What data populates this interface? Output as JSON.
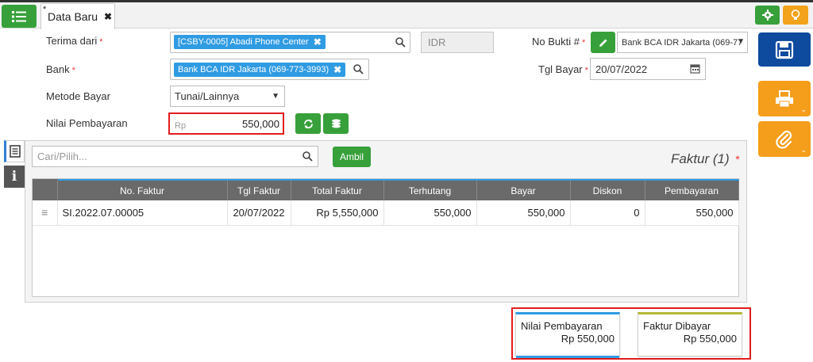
{
  "tab": {
    "title": "Data Baru",
    "modified_mark": "*"
  },
  "form": {
    "terima_dari": {
      "label": "Terima dari",
      "value": "[CSBY-0005] Abadi Phone Center"
    },
    "currency": "IDR",
    "bank": {
      "label": "Bank",
      "value": "Bank BCA IDR Jakarta (069-773-3993)"
    },
    "no_bukti": {
      "label": "No Bukti #",
      "value": "Bank BCA IDR Jakarta (069-77"
    },
    "tgl_bayar": {
      "label": "Tgl Bayar",
      "value": "20/07/2022"
    },
    "metode_bayar": {
      "label": "Metode Bayar",
      "value": "Tunai/Lainnya"
    },
    "nilai_pembayaran": {
      "label": "Nilai Pembayaran",
      "prefix": "Rp",
      "value": "550,000"
    },
    "required_mark": "*"
  },
  "faktur": {
    "search_placeholder": "Cari/Pilih...",
    "ambil_label": "Ambil",
    "title": "Faktur (1)",
    "columns": [
      "",
      "No. Faktur",
      "Tgl Faktur",
      "Total Faktur",
      "Terhutang",
      "Bayar",
      "Diskon",
      "Pembayaran"
    ],
    "rows": [
      {
        "grip": "≡",
        "no_faktur": "SI.2022.07.00005",
        "tgl_faktur": "20/07/2022",
        "total_faktur": "Rp 5,550,000",
        "terhutang": "550,000",
        "bayar": "550,000",
        "diskon": "0",
        "pembayaran": "550,000"
      }
    ]
  },
  "summary": {
    "nilai_pembayaran": {
      "label": "Nilai Pembayaran",
      "value": "Rp 550,000"
    },
    "faktur_dibayar": {
      "label": "Faktur Dibayar",
      "value": "Rp 550,000"
    }
  },
  "colors": {
    "green": "#37a03a",
    "orange": "#f59e1b",
    "navy": "#0e4a9e",
    "chip_blue": "#2f9be3",
    "highlight_red": "#e21d1d"
  }
}
